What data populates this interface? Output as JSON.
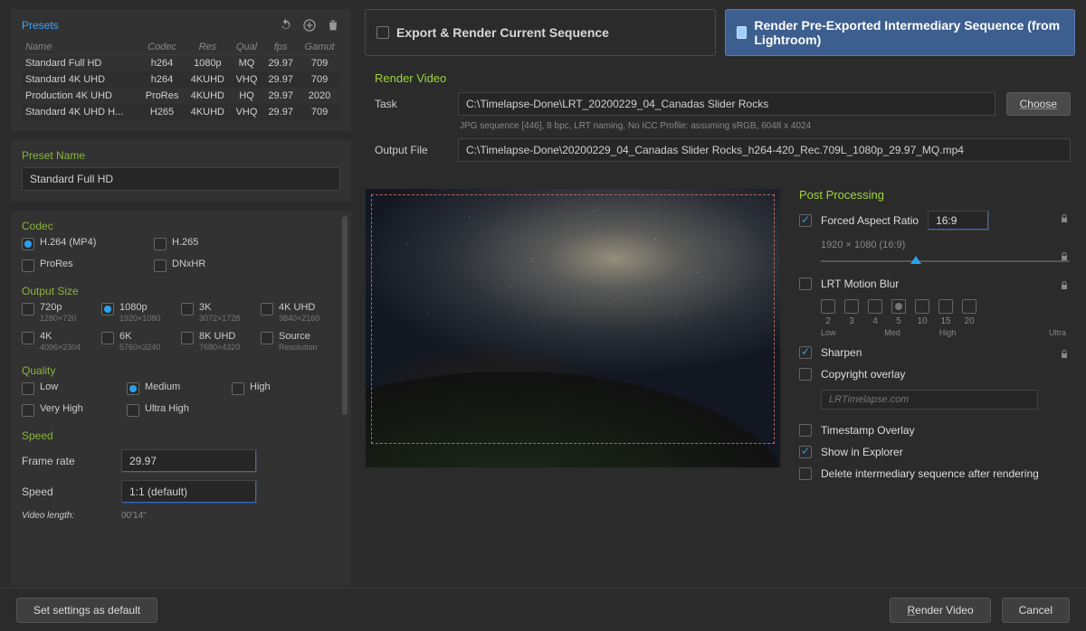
{
  "presets": {
    "title": "Presets",
    "columns": [
      "Name",
      "Codec",
      "Res",
      "Qual",
      "fps",
      "Gamut"
    ],
    "rows": [
      {
        "name": "Standard Full HD",
        "codec": "h264",
        "res": "1080p",
        "qual": "MQ",
        "fps": "29.97",
        "gamut": "709"
      },
      {
        "name": "Standard 4K UHD",
        "codec": "h264",
        "res": "4KUHD",
        "qual": "VHQ",
        "fps": "29.97",
        "gamut": "709"
      },
      {
        "name": "Production 4K UHD",
        "codec": "ProRes",
        "res": "4KUHD",
        "qual": "HQ",
        "fps": "29.97",
        "gamut": "2020"
      },
      {
        "name": "Standard 4K UHD H...",
        "codec": "H265",
        "res": "4KUHD",
        "qual": "VHQ",
        "fps": "29.97",
        "gamut": "709"
      }
    ]
  },
  "preset_name": {
    "label": "Preset Name",
    "value": "Standard Full HD"
  },
  "codec": {
    "label": "Codec",
    "opts": {
      "h264": "H.264 (MP4)",
      "h265": "H.265",
      "prores": "ProRes",
      "dnxhr": "DNxHR"
    }
  },
  "output_size": {
    "label": "Output Size",
    "opts": {
      "720p": {
        "t": "720p",
        "s": "1280×720"
      },
      "1080p": {
        "t": "1080p",
        "s": "1920×1080"
      },
      "3k": {
        "t": "3K",
        "s": "3072×1728"
      },
      "4kuhd": {
        "t": "4K UHD",
        "s": "3840×2160"
      },
      "4k": {
        "t": "4K",
        "s": "4096×2304"
      },
      "6k": {
        "t": "6K",
        "s": "5760×3240"
      },
      "8kuhd": {
        "t": "8K UHD",
        "s": "7680×4320"
      },
      "source": {
        "t": "Source",
        "s": "Resolution"
      }
    }
  },
  "quality": {
    "label": "Quality",
    "opts": {
      "low": "Low",
      "medium": "Medium",
      "high": "High",
      "vhigh": "Very High",
      "uhigh": "Ultra High"
    }
  },
  "speed": {
    "label": "Speed",
    "frame_rate_label": "Frame rate",
    "frame_rate_value": "29.97",
    "speed_label": "Speed",
    "speed_value": "1:1 (default)",
    "video_length_label": "Video length:",
    "video_length_value": "00'14\""
  },
  "tabs": {
    "export": "Export & Render Current Sequence",
    "render": "Render Pre-Exported Intermediary Sequence (from Lightroom)"
  },
  "render_video": {
    "title": "Render Video",
    "task_label": "Task",
    "task_value": "C:\\Timelapse-Done\\LRT_20200229_04_Canadas Slider Rocks",
    "choose": "Choose",
    "info": "JPG sequence [446], 8 bpc, LRT naming, No ICC Profile: assuming sRGB, 6048 x 4024",
    "output_label": "Output File",
    "output_value": "C:\\Timelapse-Done\\20200229_04_Canadas Slider Rocks_h264-420_Rec.709L_1080p_29.97_MQ.mp4"
  },
  "post": {
    "title": "Post Processing",
    "forced_aspect": "Forced Aspect Ratio",
    "aspect_value": "16:9",
    "dims": "1920 × 1080 (16:9)",
    "motion_blur": "LRT Motion Blur",
    "mb_vals": [
      "2",
      "3",
      "4",
      "5",
      "10",
      "15",
      "20"
    ],
    "mb_desc": {
      "low": "Low",
      "med": "Med",
      "high": "High",
      "ultra": "Ultra"
    },
    "sharpen": "Sharpen",
    "copyright": "Copyright overlay",
    "copyright_ph": "LRTimelapse.com",
    "timestamp": "Timestamp Overlay",
    "show_explorer": "Show in Explorer",
    "delete_intermed": "Delete intermediary sequence after rendering"
  },
  "footer": {
    "save_default": "Set settings as default",
    "render": "Render Video",
    "cancel": "Cancel"
  }
}
